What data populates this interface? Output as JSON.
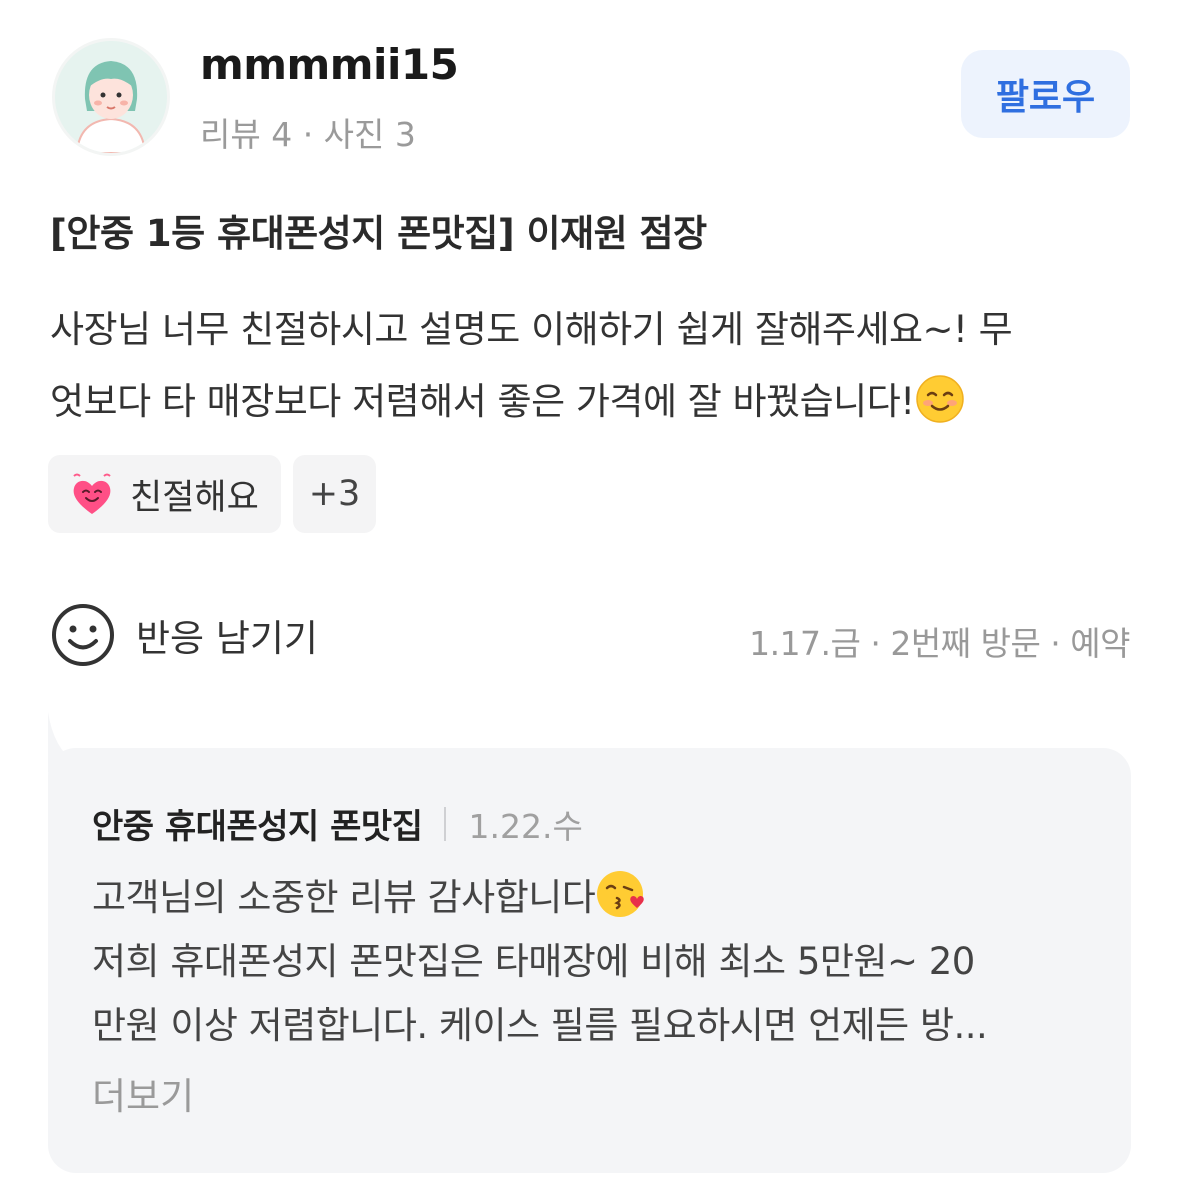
{
  "profile": {
    "username": "mmmmii15",
    "stats": "리뷰 4 · 사진 3",
    "follow_label": "팔로우"
  },
  "review": {
    "place_title": "[안중 1등 휴대폰성지 폰맛집] 이재원 점장",
    "body_line1": "사장님 너무 친절하시고 설명도 이해하기 쉽게 잘해주세요~! 무",
    "body_line2": "엇보다 타 매장보다 저렴해서 좋은 가격에 잘 바꿨습니다!",
    "tags": [
      {
        "label": "친절해요",
        "icon": "heart-face-icon"
      }
    ],
    "tags_more": "+3",
    "react_label": "반응 남기기",
    "visit_meta": "1.17.금 · 2번째 방문 · 예약"
  },
  "reply": {
    "owner": "안중 휴대폰성지 폰맛집",
    "date": "1.22.수",
    "line1": "고객님의 소중한 리뷰 감사합니다",
    "line2": "저희 휴대폰성지 폰맛집은 타매장에 비해 최소 5만원~ 20",
    "line3": "만원 이상 저렴합니다. 케이스 필름 필요하시면 언제든 방...",
    "more_label": "더보기"
  },
  "colors": {
    "accent": "#2f6fe0",
    "follow_bg": "#edf3fd",
    "reply_bg": "#f4f5f7",
    "muted": "#999999"
  }
}
